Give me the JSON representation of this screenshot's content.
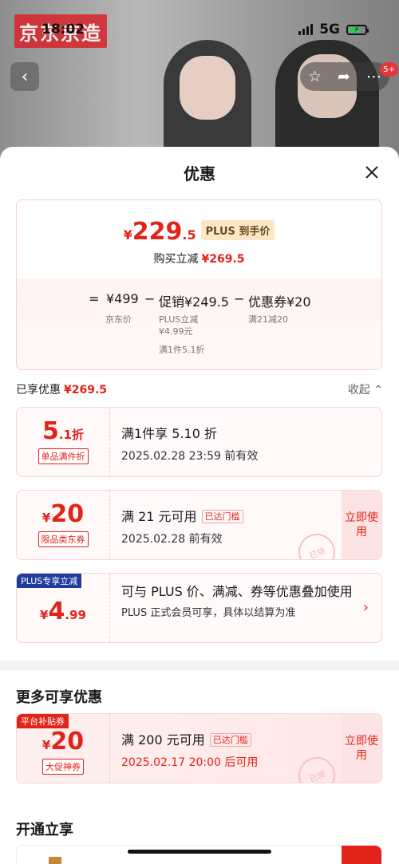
{
  "status_bar": {
    "time": "18:02",
    "network": "5G"
  },
  "banner": {
    "brand": "京东京造"
  },
  "nav": {
    "badge": "5+"
  },
  "sheet": {
    "title": "优惠"
  },
  "summary": {
    "currency": "¥",
    "final_int": "229",
    "final_dec": ".5",
    "plus_tag": "PLUS 到手价",
    "reduce_label": "购买立减",
    "reduce_amount": "¥269.5",
    "eq": "=",
    "base_price": "¥499",
    "minus1": "−",
    "promo": "促销¥249.5",
    "minus2": "−",
    "coupon_deduct": "优惠券¥20",
    "base_label": "京东价",
    "promo_sub1": "PLUS立减",
    "promo_sub2": "¥4.99元",
    "promo_sub3": "满1件5.1折",
    "coupon_sub": "满21减20"
  },
  "enjoyed": {
    "label": "已享优惠",
    "amount": "¥269.5",
    "collapse": "收起"
  },
  "coupons": [
    {
      "value_main": "5",
      "value_sub": ".1折",
      "tag": "单品满件折",
      "title": "满1件享 5.10 折",
      "sub": "2025.02.28 23:59 前有效"
    },
    {
      "currency": "¥",
      "value_main": "20",
      "tag": "限品类东券",
      "title": "满 21 元可用",
      "reached": "已达门槛",
      "sub": "2025.02.28 前有效",
      "action": "立即使用",
      "stamp": "已领"
    },
    {
      "corner": "PLUS专享立减",
      "currency": "¥",
      "value_main": "4",
      "value_sub": ".99",
      "title": "可与 PLUS 价、满减、券等优惠叠加使用",
      "sub": "PLUS 正式会员可享，具体以结算为准"
    }
  ],
  "more": {
    "title": "更多可享优惠",
    "coupon": {
      "corner": "平台补贴券",
      "currency": "¥",
      "value_main": "20",
      "tag": "大促神券",
      "title": "满 200 元可用",
      "reached": "已达门槛",
      "sub": "2025.02.17 20:00 后可用",
      "action": "立即使用",
      "stamp": "已领"
    }
  },
  "open": {
    "title": "开通立享"
  },
  "colors": {
    "accent": "#e2231a",
    "plus_blue": "#1f3c9b",
    "plus_gold": "#fbe7c6"
  },
  "icons": [
    "back-icon",
    "star-icon",
    "share-icon",
    "more-icon",
    "close-icon",
    "chevron-up-icon",
    "chevron-right-icon"
  ]
}
